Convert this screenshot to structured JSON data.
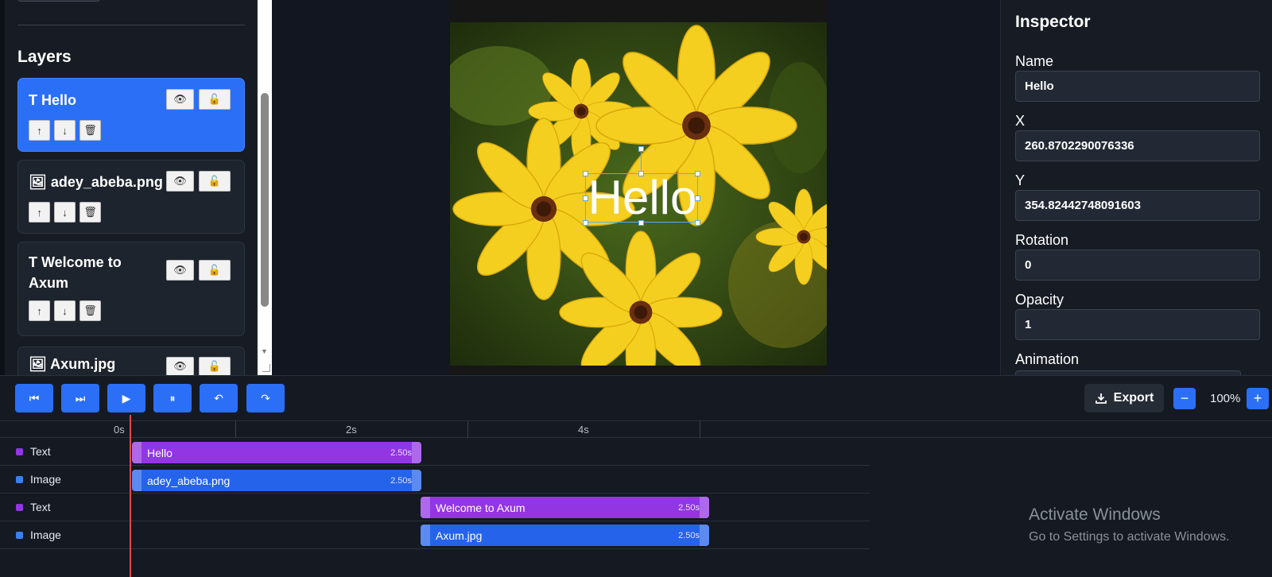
{
  "layers_panel": {
    "title": "Layers",
    "items": [
      {
        "name": "T Hello",
        "selected": true
      },
      {
        "name": "🖼 adey_abeba.png",
        "selected": false
      },
      {
        "name": "T Welcome to Axum",
        "selected": false
      },
      {
        "name": "🖼 Axum.jpg",
        "selected": false
      }
    ],
    "eye_glyph": "👁",
    "lock_glyph": "🔓",
    "up_glyph": "↑",
    "down_glyph": "↓",
    "delete_glyph": "🗑"
  },
  "canvas": {
    "hello_text": "Hello"
  },
  "inspector": {
    "title": "Inspector",
    "fields": {
      "name": {
        "label": "Name",
        "value": "Hello"
      },
      "x": {
        "label": "X",
        "value": "260.8702290076336"
      },
      "y": {
        "label": "Y",
        "value": "354.82442748091603"
      },
      "rotation": {
        "label": "Rotation",
        "value": "0"
      },
      "opacity": {
        "label": "Opacity",
        "value": "1"
      },
      "animation": {
        "label": "Animation"
      }
    }
  },
  "toolbar": {
    "skip_start_glyph": "⏮",
    "skip_end_glyph": "⏭",
    "play_glyph": "▶",
    "pause_glyph": "⏸",
    "undo_glyph": "↶",
    "redo_glyph": "↷",
    "export_label": "Export",
    "zoom_out_glyph": "−",
    "zoom_in_glyph": "+",
    "zoom_level": "100%"
  },
  "timeline": {
    "ticks": [
      "0s",
      "2s",
      "4s"
    ],
    "tracks": [
      {
        "type": "Text",
        "clip": "Hello",
        "duration": "2.50s"
      },
      {
        "type": "Image",
        "clip": "adey_abeba.png",
        "duration": "2.50s"
      },
      {
        "type": "Text",
        "clip": "Welcome to Axum",
        "duration": "2.50s"
      },
      {
        "type": "Image",
        "clip": "Axum.jpg",
        "duration": "2.50s"
      }
    ]
  },
  "colors": {
    "accent": "#2b6ff6",
    "text_clip": "#9236e4",
    "image_clip": "#2563eb",
    "playhead": "#e5484d"
  },
  "watermark": {
    "line1": "Activate Windows",
    "line2": "Go to Settings to activate Windows."
  }
}
